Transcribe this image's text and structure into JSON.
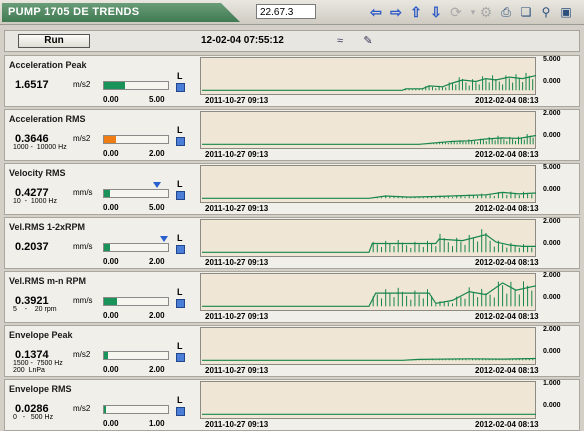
{
  "window": {
    "title": "PUMP 1705 DE  TRENDS",
    "value_field": "22.67.3"
  },
  "toolbar": {
    "icons": [
      "arrow-left-icon",
      "arrow-right-icon",
      "arrow-up-icon",
      "arrow-down-icon",
      "refresh-icon",
      "dropdown-icon",
      "settings-icon",
      "print-icon",
      "copy-icon",
      "zoom-icon",
      "fit-icon"
    ]
  },
  "controls": {
    "run_label": "Run",
    "timestamp": "12-02-04 07:55:12"
  },
  "colors": {
    "green": "#19935a",
    "orange": "#f07d14",
    "trend": "#17864a",
    "chart_bg": "#efe6d6"
  },
  "rows": [
    {
      "name": "Acceleration Peak",
      "value": "1.6517",
      "unit": "m/s2",
      "sub": "",
      "scale_min": "0.00",
      "scale_max": "5.00",
      "level": 0.33,
      "color": "green",
      "t_start": "2011-10-27 09:13",
      "t_end": "2012-02-04 08:13",
      "y_top": "5.000",
      "y_bot": "0.000",
      "trend": {
        "points": [
          [
            0.0,
            0
          ],
          [
            0.6,
            0
          ],
          [
            0.61,
            0.05
          ],
          [
            0.66,
            0.05
          ],
          [
            0.68,
            0.15
          ],
          [
            0.72,
            0.12
          ],
          [
            0.75,
            0.25
          ],
          [
            0.78,
            0.35
          ],
          [
            0.82,
            0.3
          ],
          [
            0.85,
            0.4
          ],
          [
            0.88,
            0.35
          ],
          [
            0.92,
            0.45
          ],
          [
            0.96,
            0.4
          ],
          [
            1.0,
            0.5
          ]
        ],
        "baseline": 0.85
      }
    },
    {
      "name": "Acceleration RMS",
      "value": "0.3646",
      "unit": "m/s2",
      "sub": "1000 -  10000 Hz",
      "scale_min": "0.00",
      "scale_max": "2.00",
      "level": 0.18,
      "color": "orange",
      "t_start": "2011-10-27 09:13",
      "t_end": "2012-02-04 08:13",
      "y_top": "2.000",
      "y_bot": "0.000",
      "trend": {
        "points": [
          [
            0.0,
            0
          ],
          [
            0.65,
            0
          ],
          [
            0.7,
            0.05
          ],
          [
            0.75,
            0.1
          ],
          [
            0.8,
            0.12
          ],
          [
            0.85,
            0.18
          ],
          [
            0.9,
            0.22
          ],
          [
            0.95,
            0.2
          ],
          [
            1.0,
            0.3
          ]
        ],
        "baseline": 0.85
      }
    },
    {
      "name": "Velocity RMS",
      "value": "0.4277",
      "unit": "mm/s",
      "sub": "10  -  1000 Hz",
      "scale_min": "0.00",
      "scale_max": "5.00",
      "level": 0.09,
      "color": "green",
      "tri_pos": 0.82,
      "t_start": "2011-10-27 09:13",
      "t_end": "2012-02-04 08:13",
      "y_top": "5.000",
      "y_bot": "0.000",
      "trend": {
        "points": [
          [
            0.0,
            0
          ],
          [
            0.5,
            0
          ],
          [
            0.55,
            0.08
          ],
          [
            0.62,
            0.04
          ],
          [
            0.7,
            0.06
          ],
          [
            0.8,
            0.1
          ],
          [
            0.85,
            0.12
          ],
          [
            0.9,
            0.2
          ],
          [
            0.95,
            0.15
          ],
          [
            1.0,
            0.18
          ]
        ],
        "baseline": 0.85
      }
    },
    {
      "name": "Vel.RMS 1-2xRPM",
      "value": "0.2037",
      "unit": "mm/s",
      "sub": "",
      "scale_min": "0.00",
      "scale_max": "2.00",
      "level": 0.1,
      "color": "green",
      "tri_pos": 0.93,
      "t_start": "2011-10-27 09:13",
      "t_end": "2012-02-04 08:13",
      "y_top": "2.000",
      "y_bot": "0.000",
      "trend": {
        "points": [
          [
            0.0,
            0
          ],
          [
            0.5,
            0
          ],
          [
            0.51,
            0.3
          ],
          [
            0.6,
            0.3
          ],
          [
            0.7,
            0.3
          ],
          [
            0.71,
            0.45
          ],
          [
            0.78,
            0.4
          ],
          [
            0.85,
            0.6
          ],
          [
            0.88,
            0.35
          ],
          [
            0.92,
            0.25
          ],
          [
            0.96,
            0.2
          ],
          [
            1.0,
            0.2
          ]
        ],
        "baseline": 0.85
      }
    },
    {
      "name": "Vel.RMS m-n RPM",
      "value": "0.3921",
      "unit": "mm/s",
      "sub": "5    -    20 rpm",
      "scale_min": "0.00",
      "scale_max": "2.00",
      "level": 0.2,
      "color": "green",
      "t_start": "2011-10-27 09:13",
      "t_end": "2012-02-04 08:13",
      "y_top": "2.000",
      "y_bot": "0.000",
      "trend": {
        "points": [
          [
            0.0,
            0
          ],
          [
            0.5,
            0
          ],
          [
            0.52,
            0.45
          ],
          [
            0.68,
            0.45
          ],
          [
            0.7,
            0.1
          ],
          [
            0.75,
            0.2
          ],
          [
            0.8,
            0.5
          ],
          [
            0.85,
            0.4
          ],
          [
            0.9,
            0.8
          ],
          [
            0.94,
            0.55
          ],
          [
            1.0,
            0.7
          ]
        ],
        "baseline": 0.85
      }
    },
    {
      "name": "Envelope Peak",
      "value": "0.1374",
      "unit": "m/s2",
      "sub": "1500 -  7500 Hz\n200  LnPa",
      "scale_min": "0.00",
      "scale_max": "2.00",
      "level": 0.07,
      "color": "green",
      "t_start": "2011-10-27 09:13",
      "t_end": "2012-02-04 08:13",
      "y_top": "2.000",
      "y_bot": "0.000",
      "trend": {
        "points": [
          [
            0.0,
            0
          ],
          [
            0.6,
            0
          ],
          [
            0.65,
            0.03
          ],
          [
            0.8,
            0.05
          ],
          [
            0.9,
            0.04
          ],
          [
            1.0,
            0.06
          ]
        ],
        "baseline": 0.85
      }
    },
    {
      "name": "Envelope RMS",
      "value": "0.0286",
      "unit": "m/s2",
      "sub": "0   -   500 Hz",
      "scale_min": "0.00",
      "scale_max": "1.00",
      "level": 0.03,
      "color": "green",
      "t_start": "2011-10-27 09:13",
      "t_end": "2012-02-04 08:13",
      "y_top": "1.000",
      "y_bot": "0.000",
      "trend": {
        "points": [
          [
            0.0,
            0
          ],
          [
            1.0,
            0
          ]
        ],
        "baseline": 0.85
      }
    }
  ]
}
